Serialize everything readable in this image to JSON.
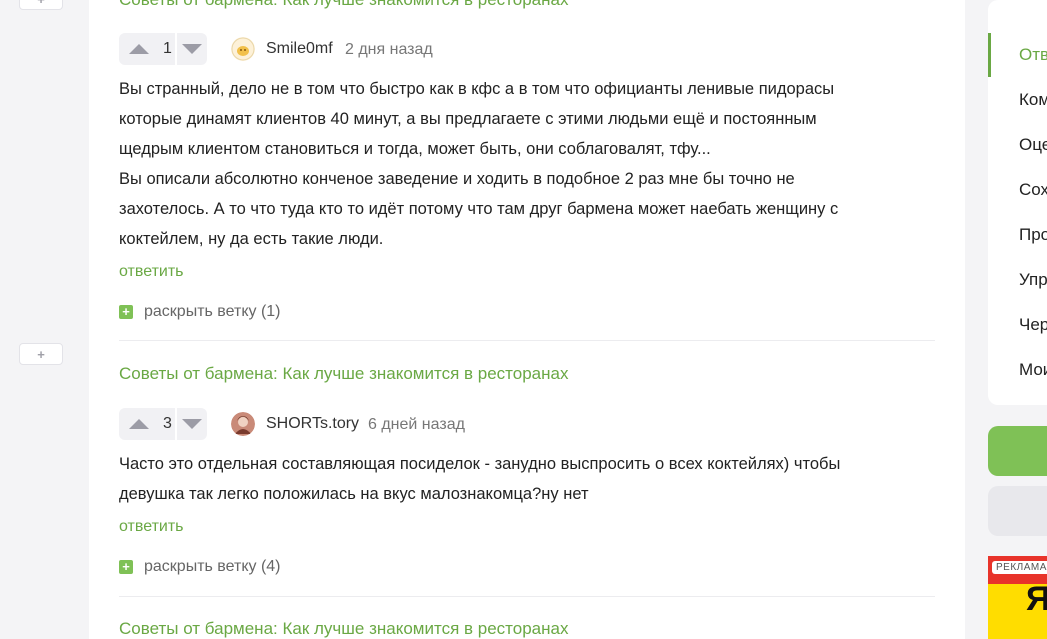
{
  "left_controls": [
    {
      "symbol": "+"
    },
    {
      "symbol": "+"
    }
  ],
  "post_title": "Советы от бармена: Как лучше знакомится в ресторанах",
  "comments": [
    {
      "votes": "1",
      "author": "Smile0mf",
      "time": "2 дня назад",
      "lines": [
        "Вы странный, дело не в том что быстро как в кфс а в том что официанты ленивые пидорасы",
        "которые динамят клиентов 40 минут, а вы предлагаете с этими людьми ещё и постоянным",
        "щедрым клиентом становиться и тогда, может быть, они соблаговалят, тфу...",
        "Вы описали абсолютно конченое заведение и ходить в подобное 2 раз мне бы точно не",
        "захотелось.  А то что туда кто то идёт потому что там друг бармена может наебать женщину с",
        "коктейлем, ну да есть такие люди."
      ],
      "reply_label": "ответить",
      "branch_label": "раскрыть ветку (1)"
    },
    {
      "votes": "3",
      "author": "SHORTs.tory",
      "time": "6 дней назад",
      "lines": [
        "Часто это отдельная составляющая посиделок - занудно выспросить о всех коктейлях) чтобы",
        "девушка так легко положилась на вкус малознакомца?ну нет"
      ],
      "reply_label": "ответить",
      "branch_label": "раскрыть ветку (4)"
    }
  ],
  "sidebar": {
    "items": [
      "Отв",
      "Ком",
      "Оце",
      "Сох",
      "Про",
      "Упр",
      "Чер",
      "Мои"
    ],
    "active_index": 0
  },
  "ad": {
    "label": "РЕКЛАМА",
    "logo": "Я"
  },
  "colors": {
    "accent": "#6aa844",
    "plus_badge": "#7fc156",
    "background": "#f4f4f6"
  }
}
